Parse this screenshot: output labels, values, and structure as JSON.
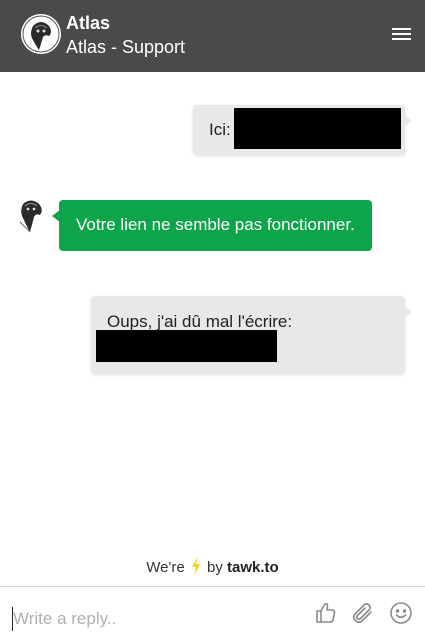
{
  "header": {
    "title": "Atlas",
    "subtitle": "Atlas - Support"
  },
  "messages": [
    {
      "sender": "visitor",
      "text": "Ici:"
    },
    {
      "sender": "agent",
      "text": "Votre lien ne semble pas fonctionner."
    },
    {
      "sender": "visitor",
      "text": "Oups, j'ai dû mal l'écrire:"
    }
  ],
  "branding": {
    "prefix": "We're",
    "by": "by",
    "brand": "tawk.to"
  },
  "composer": {
    "placeholder": "Write a reply.."
  },
  "colors": {
    "header_bg": "#4a4a4a",
    "agent_bubble": "#0ea44a",
    "visitor_bubble": "#e8e8e8",
    "bolt": "#f5d21e"
  },
  "icons": [
    "menu-icon",
    "thumbs-up-icon",
    "paperclip-icon",
    "smiley-icon",
    "lightning-icon"
  ]
}
